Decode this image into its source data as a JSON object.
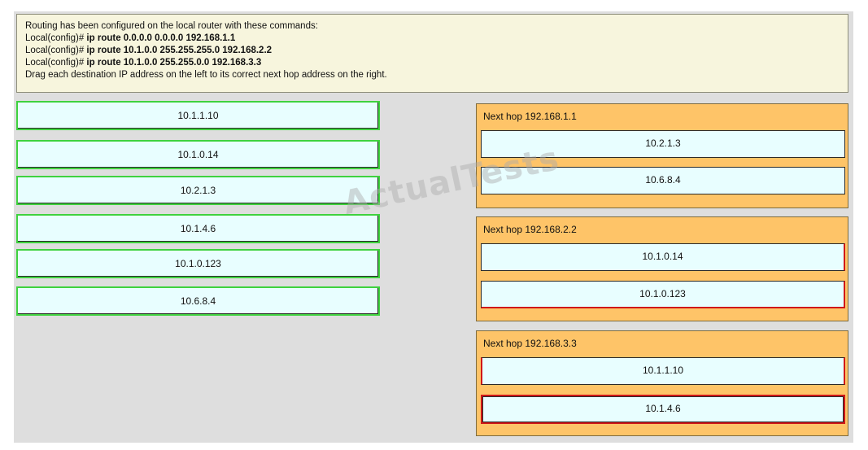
{
  "instructions": {
    "intro": "Routing has been configured on the local router with these commands:",
    "commands": [
      {
        "prompt": "Local(config)#",
        "cmd": " ip route 0.0.0.0 0.0.0.0 192.168.1.1"
      },
      {
        "prompt": "Local(config)#",
        "cmd": " ip route 10.1.0.0 255.255.255.0 192.168.2.2"
      },
      {
        "prompt": "Local(config)#",
        "cmd": " ip route 10.1.0.0 255.255.0.0 192.168.3.3"
      }
    ],
    "task": "Drag each destination IP address on the left to its correct next hop address on the right."
  },
  "sources": [
    "10.1.1.10",
    "10.1.0.14",
    "10.2.1.3",
    "10.1.4.6",
    "10.1.0.123",
    "10.6.8.4"
  ],
  "panels": [
    {
      "title": "Next hop 192.168.1.1",
      "items": [
        "10.2.1.3",
        "10.6.8.4"
      ]
    },
    {
      "title": "Next hop 192.168.2.2",
      "items": [
        "10.1.0.14",
        "10.1.0.123"
      ]
    },
    {
      "title": "Next hop 192.168.3.3",
      "items": [
        "10.1.1.10",
        "10.1.4.6"
      ]
    }
  ],
  "watermark": "ActualTests",
  "colors": {
    "source_border": "#3fd23f",
    "item_bg": "#e8feff",
    "panel_bg": "#fec468",
    "instructions_bg": "#f7f5dd",
    "error_border": "#d01818"
  }
}
